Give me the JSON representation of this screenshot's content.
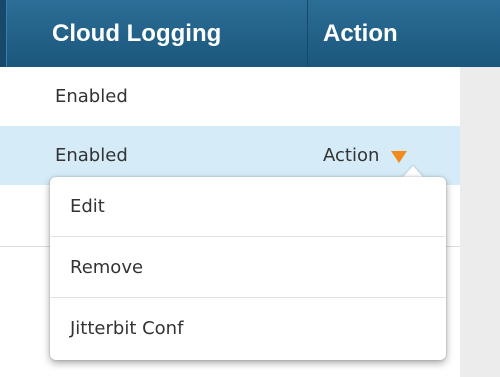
{
  "table": {
    "columns": [
      "Cloud Logging",
      "Action"
    ],
    "rows": [
      {
        "cloud_logging": "Enabled"
      },
      {
        "cloud_logging": "Enabled",
        "action_label": "Action"
      }
    ]
  },
  "dropdown": {
    "items": [
      "Edit",
      "Remove",
      "Jitterbit Conf"
    ]
  },
  "colors": {
    "header_background": "#1f5f87",
    "selected_row_background": "#d5ecf8",
    "caret_accent": "#f28a1d"
  },
  "icons": {
    "action_caret": "caret-down-icon"
  }
}
